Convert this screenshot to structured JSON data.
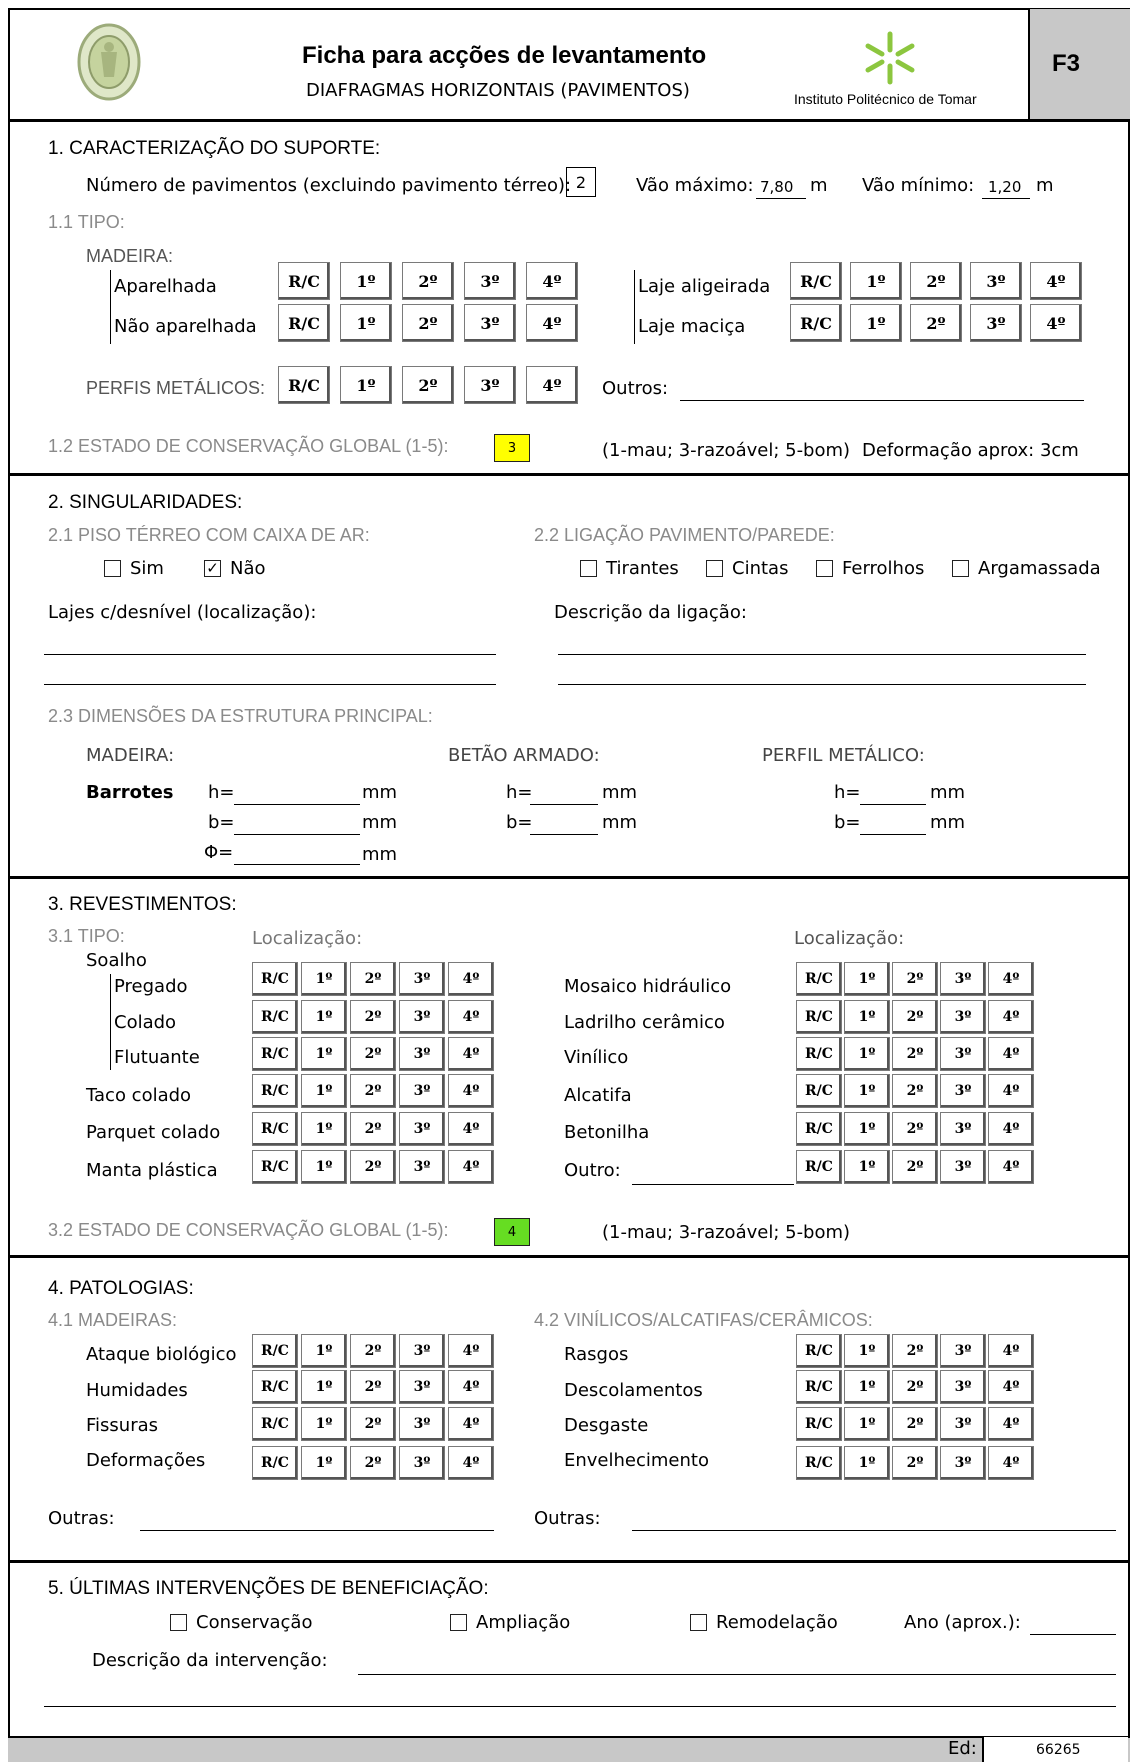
{
  "colors": {
    "score1": "#ffff00",
    "score2": "#66dd22",
    "header_grey": "#c8c8c8",
    "muted": "#8a8a8a"
  },
  "header": {
    "title": "Ficha para acções de levantamento",
    "subtitle": "DIAFRAGMAS HORIZONTAIS (PAVIMENTOS)",
    "institute": "Instituto Politécnico de Tomar",
    "code": "F3"
  },
  "floors": [
    "R/C",
    "1º",
    "2º",
    "3º",
    "4º"
  ],
  "s1": {
    "title": "1. CARACTERIZAÇÃO DO SUPORTE:",
    "num_label": "Número de pavimentos (excluindo pavimento térreo):",
    "num_value": "2",
    "vmax_label": "Vão máximo:",
    "vmax_value": "7,80",
    "vmax_unit": "m",
    "vmin_label": "Vão mínimo:",
    "vmin_value": "1,20",
    "vmin_unit": "m",
    "sub1": "1.1 TIPO:",
    "madeira": "MADEIRA:",
    "aparelhada": "Aparelhada",
    "nao_aparelhada": "Não aparelhada",
    "laje_alig": "Laje aligeirada",
    "laje_macica": "Laje maciça",
    "perfis": "PERFIS METÁLICOS:",
    "outros": "Outros:",
    "sub2": "1.2 ESTADO DE CONSERVAÇÃO GLOBAL (1-5):",
    "score": "3",
    "legend": "(1-mau; 3-razoável; 5-bom)",
    "deform": "Deformação aprox: 3cm"
  },
  "s2": {
    "title": "2. SINGULARIDADES:",
    "sub1": "2.1 PISO TÉRREO COM CAIXA DE AR:",
    "sim": "Sim",
    "nao": "Não",
    "sub2": "2.2 LIGAÇÃO PAVIMENTO/PAREDE:",
    "tirantes": "Tirantes",
    "cintas": "Cintas",
    "ferrolhos": "Ferrolhos",
    "argamassada": "Argamassada",
    "lajes": "Lajes c/desnível (localização):",
    "descricao": "Descrição da ligação:",
    "sub3": "2.3 DIMENSÕES DA ESTRUTURA PRINCIPAL:",
    "madeira": "MADEIRA:",
    "betao": "BETÃO ARMADO:",
    "perfil": "PERFIL METÁLICO:",
    "barrotes": "Barrotes",
    "h": "h=",
    "b": "b=",
    "phi": "Φ=",
    "mm": "mm"
  },
  "s3": {
    "title": "3. REVESTIMENTOS:",
    "sub1": "3.1 TIPO:",
    "loc": "Localização:",
    "soalho": "Soalho",
    "left": [
      "Pregado",
      "Colado",
      "Flutuante",
      "Taco colado",
      "Parquet colado",
      "Manta plástica"
    ],
    "right": [
      "Mosaico hidráulico",
      "Ladrilho cerâmico",
      "Vinílico",
      "Alcatifa",
      "Betonilha",
      "Outro:"
    ],
    "sub2": "3.2 ESTADO DE CONSERVAÇÃO GLOBAL (1-5):",
    "score": "4",
    "legend": "(1-mau; 3-razoável; 5-bom)"
  },
  "s4": {
    "title": "4. PATOLOGIAS:",
    "sub1": "4.1 MADEIRAS:",
    "sub2": "4.2 VINÍLICOS/ALCATIFAS/CERÂMICOS:",
    "left": [
      "Ataque biológico",
      "Humidades",
      "Fissuras",
      "Deformações"
    ],
    "right": [
      "Rasgos",
      "Descolamentos",
      "Desgaste",
      "Envelhecimento"
    ],
    "outras": "Outras:"
  },
  "s5": {
    "title": "5. ÚLTIMAS INTERVENÇÕES DE BENEFICIAÇÃO:",
    "conservacao": "Conservação",
    "ampliacao": "Ampliação",
    "remodelacao": "Remodelação",
    "ano": "Ano (aprox.):",
    "descricao": "Descrição da intervenção:"
  },
  "footer": {
    "ed_label": "Ed:",
    "ed_value": "66265"
  }
}
